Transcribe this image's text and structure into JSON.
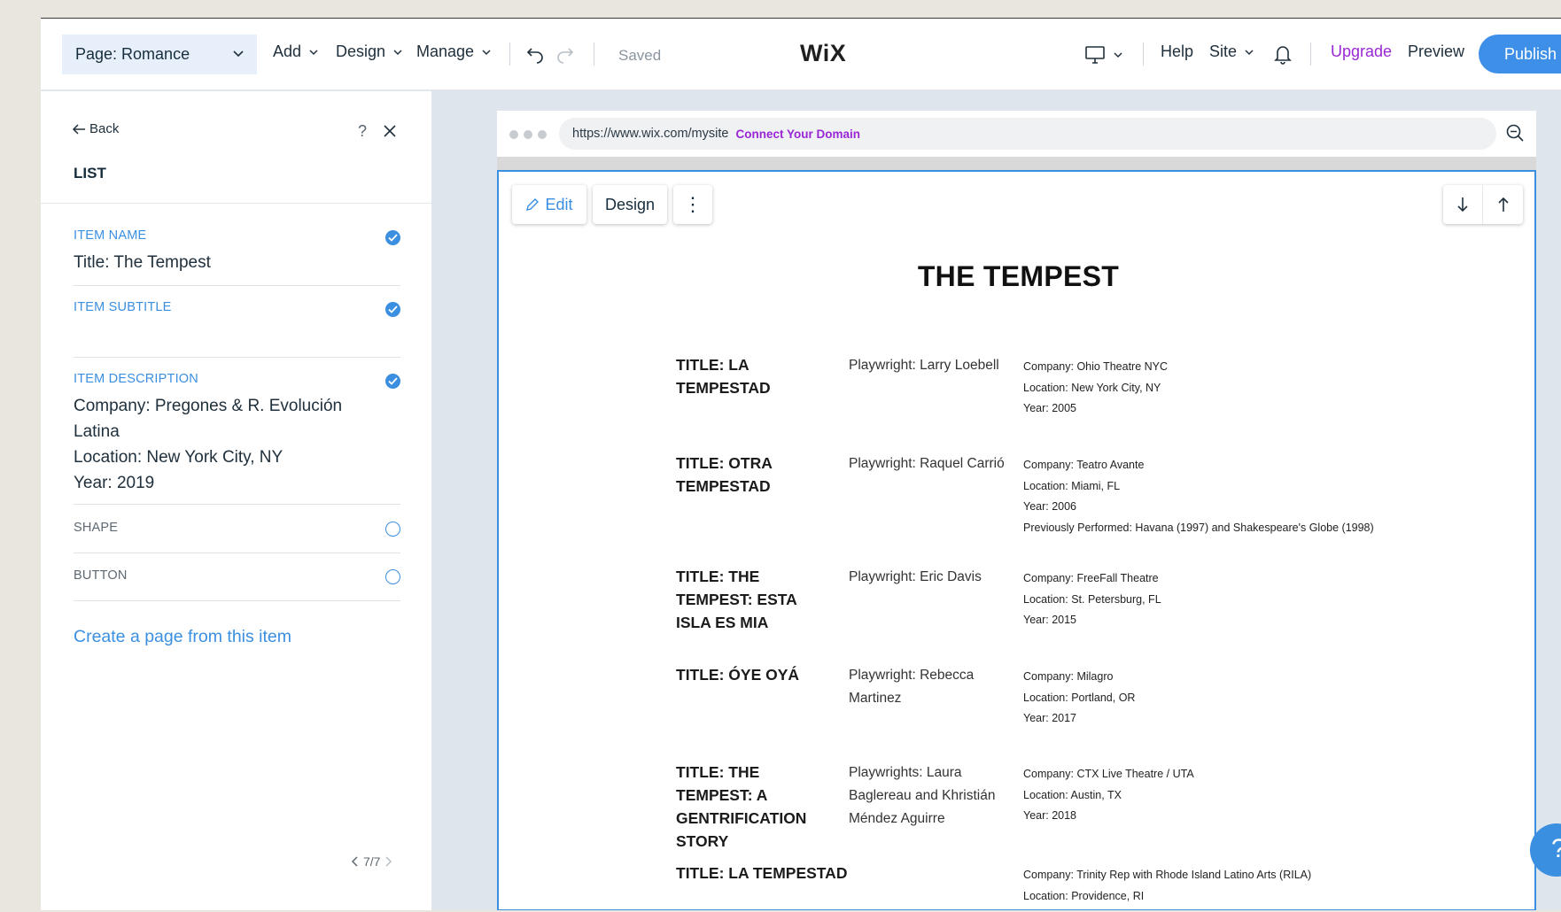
{
  "topbar": {
    "page_selector": "Page: Romance",
    "menu": {
      "add": "Add",
      "design": "Design",
      "manage": "Manage"
    },
    "saved_status": "Saved",
    "logo": "WiX",
    "help": "Help",
    "site": "Site",
    "upgrade": "Upgrade",
    "preview": "Preview",
    "publish": "Publish"
  },
  "panel": {
    "back": "Back",
    "help_glyph": "?",
    "title": "LIST",
    "fields": {
      "item_name": {
        "label": "ITEM NAME",
        "value": "Title: The Tempest"
      },
      "item_subtitle": {
        "label": "ITEM SUBTITLE",
        "value": ""
      },
      "item_description": {
        "label": "ITEM DESCRIPTION",
        "value": "Company: Pregones & R. Evolución\nLatina\nLocation: New York City, NY\nYear: 2019"
      },
      "shape": {
        "label": "SHAPE"
      },
      "button": {
        "label": "BUTTON"
      }
    },
    "create_link": "Create a page from this item",
    "pager": "7/7"
  },
  "browser": {
    "url": "https://www.wix.com/mysite",
    "connect_domain": "Connect Your Domain"
  },
  "canvas": {
    "edit": "Edit",
    "design": "Design",
    "more_glyph": "⋮",
    "title": "THE TEMPEST",
    "items": [
      {
        "title": "TITLE: LA TEMPESTAD",
        "subtitle": "Playwright: Larry Loebell",
        "description": "Company: Ohio Theatre NYC\nLocation: New York City, NY\nYear: 2005"
      },
      {
        "title": "TITLE: OTRA TEMPESTAD",
        "subtitle": "Playwright: Raquel Carrió",
        "description": "Company: Teatro Avante\nLocation: Miami, FL\nYear: 2006\nPreviously Performed: Havana (1997) and Shakespeare's Globe (1998)"
      },
      {
        "title": "TITLE: THE TEMPEST: ESTA ISLA ES MIA",
        "subtitle": "Playwright: Eric Davis",
        "description": "Company: FreeFall Theatre\nLocation: St. Petersburg, FL\nYear: 2015"
      },
      {
        "title": "TITLE: ÓYE OYÁ",
        "subtitle": "Playwright: Rebecca\nMartinez",
        "description": "Company: Milagro\nLocation: Portland, OR\nYear: 2017"
      },
      {
        "title": "TITLE: THE TEMPEST: A GENTRIFICATION STORY",
        "subtitle": "Playwrights: Laura\nBaglereau and Khristián\nMéndez Aguirre",
        "description": "Company: CTX Live Theatre / UTA\nLocation: Austin, TX\nYear: 2018"
      },
      {
        "title": "TITLE: LA TEMPESTAD",
        "subtitle": "",
        "description": "Company: Trinity Rep with Rhode Island Latino Arts (RILA)\nLocation: Providence, RI"
      }
    ]
  },
  "help_bubble": "?",
  "colors": {
    "accent": "#3b8fe0",
    "upgrade": "#9a27d5",
    "publish_bg": "#3d8fe8"
  }
}
